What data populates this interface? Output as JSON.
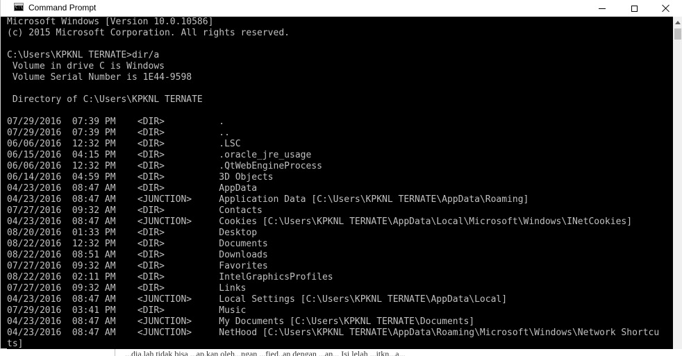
{
  "window": {
    "title": "Command Prompt"
  },
  "console": {
    "lines": [
      "Microsoft Windows [Version 10.0.10586]",
      "(c) 2015 Microsoft Corporation. All rights reserved.",
      "",
      "C:\\Users\\KPKNL TERNATE>dir/a",
      " Volume in drive C is Windows",
      " Volume Serial Number is 1E44-9598",
      "",
      " Directory of C:\\Users\\KPKNL TERNATE",
      "",
      "07/29/2016  07:39 PM    <DIR>          .",
      "07/29/2016  07:39 PM    <DIR>          ..",
      "06/06/2016  12:32 PM    <DIR>          .LSC",
      "06/15/2016  04:15 PM    <DIR>          .oracle_jre_usage",
      "06/06/2016  12:32 PM    <DIR>          .QtWebEngineProcess",
      "06/14/2016  04:59 PM    <DIR>          3D Objects",
      "04/23/2016  08:47 AM    <DIR>          AppData",
      "04/23/2016  08:47 AM    <JUNCTION>     Application Data [C:\\Users\\KPKNL TERNATE\\AppData\\Roaming]",
      "07/27/2016  09:32 AM    <DIR>          Contacts",
      "04/23/2016  08:47 AM    <JUNCTION>     Cookies [C:\\Users\\KPKNL TERNATE\\AppData\\Local\\Microsoft\\Windows\\INetCookies]",
      "08/20/2016  01:33 PM    <DIR>          Desktop",
      "08/22/2016  12:32 PM    <DIR>          Documents",
      "08/22/2016  08:51 AM    <DIR>          Downloads",
      "07/27/2016  09:32 AM    <DIR>          Favorites",
      "08/22/2016  02:11 PM    <DIR>          IntelGraphicsProfiles",
      "07/27/2016  09:32 AM    <DIR>          Links",
      "04/23/2016  08:47 AM    <JUNCTION>     Local Settings [C:\\Users\\KPKNL TERNATE\\AppData\\Local]",
      "07/29/2016  03:41 PM    <DIR>          Music",
      "04/23/2016  08:47 AM    <JUNCTION>     My Documents [C:\\Users\\KPKNL TERNATE\\Documents]",
      "04/23/2016  08:47 AM    <JUNCTION>     NetHood [C:\\Users\\KPKNL TERNATE\\AppData\\Roaming\\Microsoft\\Windows\\Network Shortcu",
      "ts]"
    ]
  },
  "background_doc": {
    "snippet": "...dia.lah tidak bisa ...ap.kan oleh...ngan ...fied..an dengan ...an... Isi lelah ...itkn...a..."
  }
}
